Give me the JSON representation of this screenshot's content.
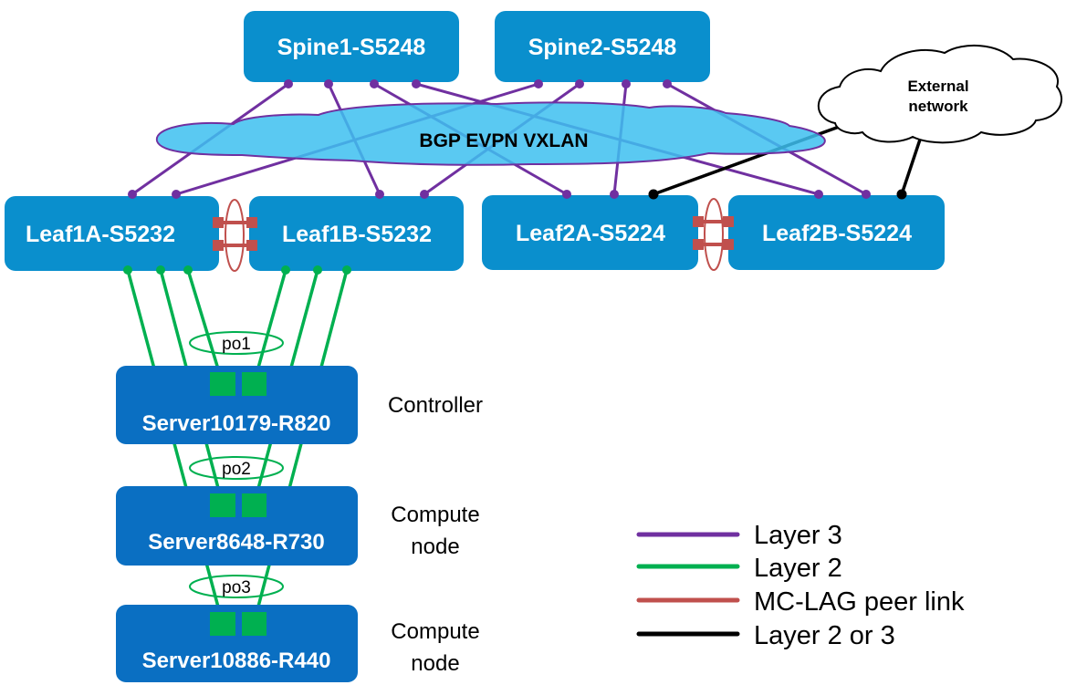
{
  "colors": {
    "switch": "#0a8fcd",
    "server": "#0a6fc2",
    "layer3": "#7030a0",
    "layer2": "#00b050",
    "peer_link": "#c0504d",
    "layer2or3": "#000000",
    "fabric_cloud": "#3dbff0"
  },
  "spines": [
    {
      "id": "spine1",
      "label": "Spine1-S5248"
    },
    {
      "id": "spine2",
      "label": "Spine2-S5248"
    }
  ],
  "leaves": [
    {
      "id": "leaf1a",
      "label": "Leaf1A-S5232"
    },
    {
      "id": "leaf1b",
      "label": "Leaf1B-S5232"
    },
    {
      "id": "leaf2a",
      "label": "Leaf2A-S5224"
    },
    {
      "id": "leaf2b",
      "label": "Leaf2B-S5224"
    }
  ],
  "fabric": {
    "label": "BGP EVPN VXLAN"
  },
  "external": {
    "line1": "External",
    "line2": "network"
  },
  "servers": [
    {
      "id": "server1",
      "label": "Server10179-R820",
      "role_line1": "Controller",
      "role_line2": "",
      "port_channel": "po1"
    },
    {
      "id": "server2",
      "label": "Server8648-R730",
      "role_line1": "Compute",
      "role_line2": "node",
      "port_channel": "po2"
    },
    {
      "id": "server3",
      "label": "Server10886-R440",
      "role_line1": "Compute",
      "role_line2": "node",
      "port_channel": "po3"
    }
  ],
  "links": {
    "layer3": [
      [
        "spine1",
        "leaf1a"
      ],
      [
        "spine1",
        "leaf1b"
      ],
      [
        "spine1",
        "leaf2a"
      ],
      [
        "spine1",
        "leaf2b"
      ],
      [
        "spine2",
        "leaf1a"
      ],
      [
        "spine2",
        "leaf1b"
      ],
      [
        "spine2",
        "leaf2a"
      ],
      [
        "spine2",
        "leaf2b"
      ]
    ],
    "layer2": [
      [
        "leaf1a",
        "server1"
      ],
      [
        "leaf1a",
        "server2"
      ],
      [
        "leaf1a",
        "server3"
      ],
      [
        "leaf1b",
        "server1"
      ],
      [
        "leaf1b",
        "server2"
      ],
      [
        "leaf1b",
        "server3"
      ]
    ],
    "peer_link": [
      [
        "leaf1a",
        "leaf1b"
      ],
      [
        "leaf2a",
        "leaf2b"
      ]
    ],
    "layer2or3": [
      [
        "leaf2a",
        "external"
      ],
      [
        "leaf2b",
        "external"
      ]
    ]
  },
  "legend": [
    {
      "key": "layer3",
      "label": "Layer 3"
    },
    {
      "key": "layer2",
      "label": "Layer 2"
    },
    {
      "key": "peer_link",
      "label": "MC-LAG peer link"
    },
    {
      "key": "layer2or3",
      "label": "Layer 2 or 3"
    }
  ]
}
